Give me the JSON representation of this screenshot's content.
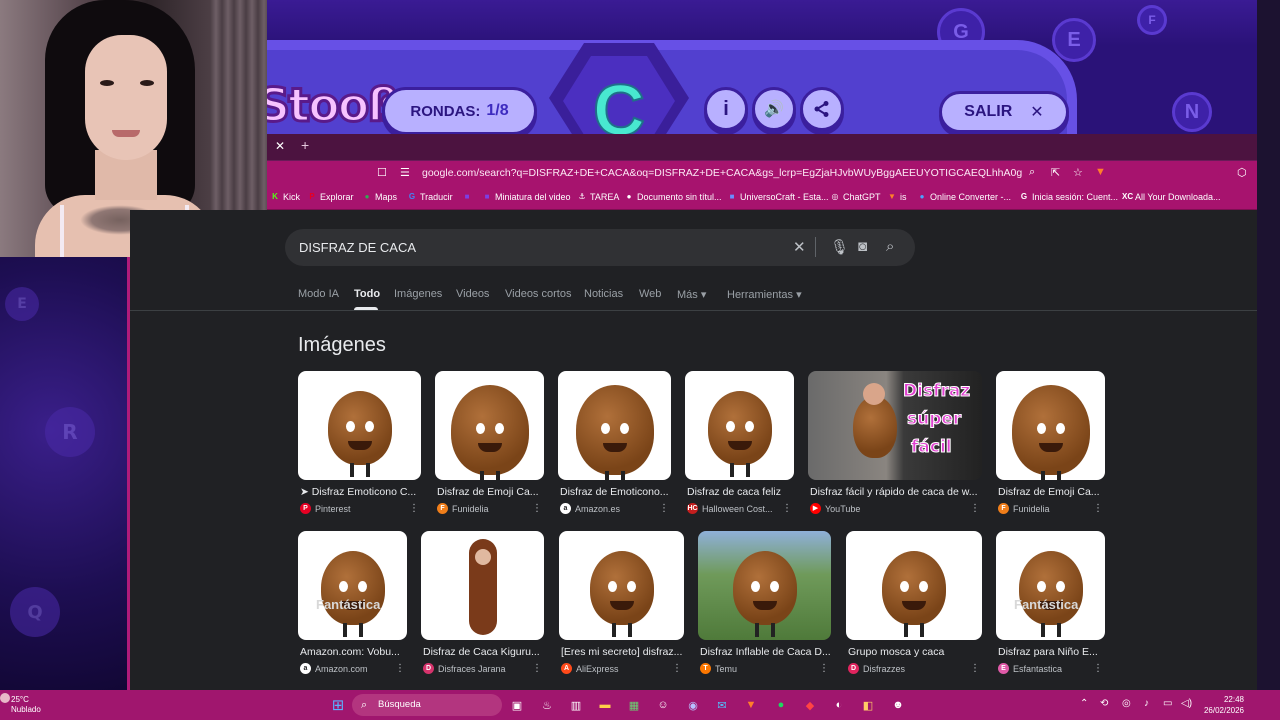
{
  "game": {
    "logo_text": "Stooß",
    "rounds_label": "RONDAS:",
    "rounds_value": "1/8",
    "letter": "C",
    "info_icon": "i",
    "sound_icon": "🔊",
    "share_icon": "share-icon",
    "exit_label": "SALIR",
    "exit_icon": "✕"
  },
  "browser": {
    "tab_close": "✕",
    "new_tab": "+",
    "url": "google.com/search?q=DISFRAZ+DE+CACA&oq=DISFRAZ+DE+CACA&gs_lcrp=EgZjaHJvbWUyBggAEEUYOTIGCAEQLhhA0gEIMzMzNWowajGo...",
    "bookmarks": [
      {
        "label": "Kick",
        "icon": "K",
        "color": "#53fc18"
      },
      {
        "label": "Explorar",
        "icon": "P",
        "color": "#e60023"
      },
      {
        "label": "Maps",
        "icon": "●",
        "color": "#34a853"
      },
      {
        "label": "Traducir",
        "icon": "G",
        "color": "#4285f4"
      },
      {
        "label": "",
        "icon": "■",
        "color": "#7b3fe4"
      },
      {
        "label": "Miniatura del video",
        "icon": "■",
        "color": "#7b3fe4"
      },
      {
        "label": "TAREA",
        "icon": "⚓",
        "color": "#ffffff"
      },
      {
        "label": "Documento sin títul...",
        "icon": "●",
        "color": "#ffffff"
      },
      {
        "label": "UniversoCraft - Esta...",
        "icon": "■",
        "color": "#6a8cff"
      },
      {
        "label": "ChatGPT",
        "icon": "◎",
        "color": "#ffffff"
      },
      {
        "label": "is",
        "icon": "▼",
        "color": "#ff7f2a"
      },
      {
        "label": "Online Converter -...",
        "icon": "●",
        "color": "#4aa3ff"
      },
      {
        "label": "Inicia sesión: Cuent...",
        "icon": "G",
        "color": "#ffffff"
      },
      {
        "label": "All Your Downloada...",
        "icon": "XC",
        "color": "#ffffff"
      }
    ]
  },
  "google": {
    "query": "DISFRAZ DE CACA",
    "tabs": [
      "Modo IA",
      "Todo",
      "Imágenes",
      "Videos",
      "Videos cortos",
      "Noticias",
      "Web",
      "Más ▾",
      "Herramientas ▾"
    ],
    "images_heading": "Imágenes",
    "row1": [
      {
        "title": "➤ Disfraz Emoticono C...",
        "source": "Pinterest",
        "src_icon": "P",
        "src_color": "#e60023"
      },
      {
        "title": "Disfraz de Emoji Ca...",
        "source": "Funidelia",
        "src_icon": "F",
        "src_color": "#f07e1a"
      },
      {
        "title": "Disfraz de Emoticono...",
        "source": "Amazon.es",
        "src_icon": "a",
        "src_color": "#ffffff"
      },
      {
        "title": "Disfraz de caca feliz",
        "source": "Halloween Cost...",
        "src_icon": "HC",
        "src_color": "#c41e1e"
      },
      {
        "title": "Disfraz fácil y rápido de caca de w...",
        "source": "YouTube",
        "src_icon": "▶",
        "src_color": "#ff0000"
      },
      {
        "title": "Disfraz de Emoji Ca...",
        "source": "Funidelia",
        "src_icon": "F",
        "src_color": "#f07e1a"
      }
    ],
    "row2": [
      {
        "title": "Amazon.com: Vobu...",
        "source": "Amazon.com",
        "src_icon": "a",
        "src_color": "#ffffff"
      },
      {
        "title": "Disfraz de Caca Kiguru...",
        "source": "Disfraces Jarana",
        "src_icon": "D",
        "src_color": "#d6336c"
      },
      {
        "title": "[Eres mi secreto] disfraz...",
        "source": "AliExpress",
        "src_icon": "A",
        "src_color": "#ff4a1a"
      },
      {
        "title": "Disfraz Inflable de Caca D...",
        "source": "Temu",
        "src_icon": "T",
        "src_color": "#fb7701"
      },
      {
        "title": "Grupo mosca y caca",
        "source": "Disfrazzes",
        "src_icon": "D",
        "src_color": "#e0245e"
      },
      {
        "title": "Disfraz para Niño E...",
        "source": "Esfantastica",
        "src_icon": "E",
        "src_color": "#e05aa8"
      }
    ],
    "yt_overlay": [
      "Disfraz",
      "súper",
      "fácil"
    ],
    "kid_watermark": "Fantástica"
  },
  "taskbar": {
    "temp": "25°C",
    "weather": "Nublado",
    "search_placeholder": "Búsqueda",
    "time": "22:48",
    "date": "26/02/2026"
  },
  "colors": {
    "accent": "#a7136e",
    "page_bg": "#202124",
    "game_bg": "#2a1278"
  }
}
